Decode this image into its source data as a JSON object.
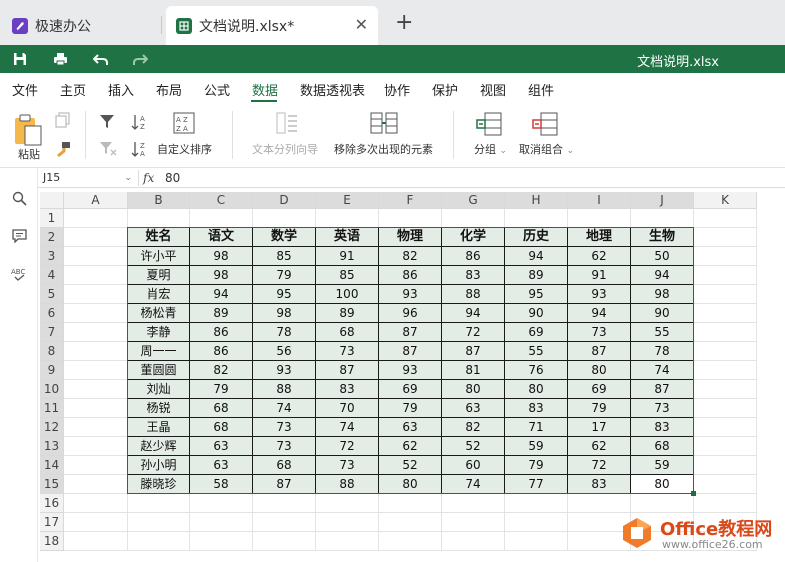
{
  "tabs": [
    {
      "label": "极速办公",
      "icon": "rocket-icon"
    },
    {
      "label": "文档说明.xlsx*",
      "icon": "spreadsheet-icon"
    }
  ],
  "quickbar": {
    "title": "文档说明.xlsx"
  },
  "menu": [
    "文件",
    "主页",
    "插入",
    "布局",
    "公式",
    "数据",
    "数据透视表",
    "协作",
    "保护",
    "视图",
    "组件"
  ],
  "menu_active": "数据",
  "ribbon": {
    "paste": "粘贴",
    "custom_sort": "自定义排序",
    "text_to_columns": "文本分列向导",
    "remove_duplicates": "移除多次出现的元素",
    "group": "分组",
    "ungroup": "取消组合"
  },
  "formula_bar": {
    "cell_ref": "J15",
    "fx": "fx",
    "value": "80"
  },
  "columns": [
    "A",
    "B",
    "C",
    "D",
    "E",
    "F",
    "G",
    "H",
    "I",
    "J",
    "K"
  ],
  "rows": [
    "1",
    "2",
    "3",
    "4",
    "5",
    "6",
    "7",
    "8",
    "9",
    "10",
    "11",
    "12",
    "13",
    "14",
    "15",
    "16",
    "17",
    "18"
  ],
  "table": {
    "headers": [
      "姓名",
      "语文",
      "数学",
      "英语",
      "物理",
      "化学",
      "历史",
      "地理",
      "生物"
    ],
    "rows": [
      [
        "许小平",
        "98",
        "85",
        "91",
        "82",
        "86",
        "94",
        "62",
        "50"
      ],
      [
        "夏明",
        "98",
        "79",
        "85",
        "86",
        "83",
        "89",
        "91",
        "94"
      ],
      [
        "肖宏",
        "94",
        "95",
        "100",
        "93",
        "88",
        "95",
        "93",
        "98"
      ],
      [
        "杨松青",
        "89",
        "98",
        "89",
        "96",
        "94",
        "90",
        "94",
        "90"
      ],
      [
        "李静",
        "86",
        "78",
        "68",
        "87",
        "72",
        "69",
        "73",
        "55"
      ],
      [
        "周一一",
        "86",
        "56",
        "73",
        "87",
        "87",
        "55",
        "87",
        "78"
      ],
      [
        "董圆圆",
        "82",
        "93",
        "87",
        "93",
        "81",
        "76",
        "80",
        "74"
      ],
      [
        "刘灿",
        "79",
        "88",
        "83",
        "69",
        "80",
        "80",
        "69",
        "87"
      ],
      [
        "杨锐",
        "68",
        "74",
        "70",
        "79",
        "63",
        "83",
        "79",
        "73"
      ],
      [
        "王晶",
        "68",
        "73",
        "74",
        "63",
        "82",
        "71",
        "17",
        "83"
      ],
      [
        "赵少辉",
        "63",
        "73",
        "72",
        "62",
        "52",
        "59",
        "62",
        "68"
      ],
      [
        "孙小明",
        "63",
        "68",
        "73",
        "52",
        "60",
        "79",
        "72",
        "59"
      ],
      [
        "滕晓珍",
        "58",
        "87",
        "88",
        "80",
        "74",
        "77",
        "83",
        "80"
      ]
    ]
  },
  "watermark": {
    "brand": "Office教程网",
    "url": "www.office26.com"
  },
  "colors": {
    "accent": "#1f7244",
    "table_fill": "#e4ece6",
    "watermark": "#d94a1a"
  }
}
